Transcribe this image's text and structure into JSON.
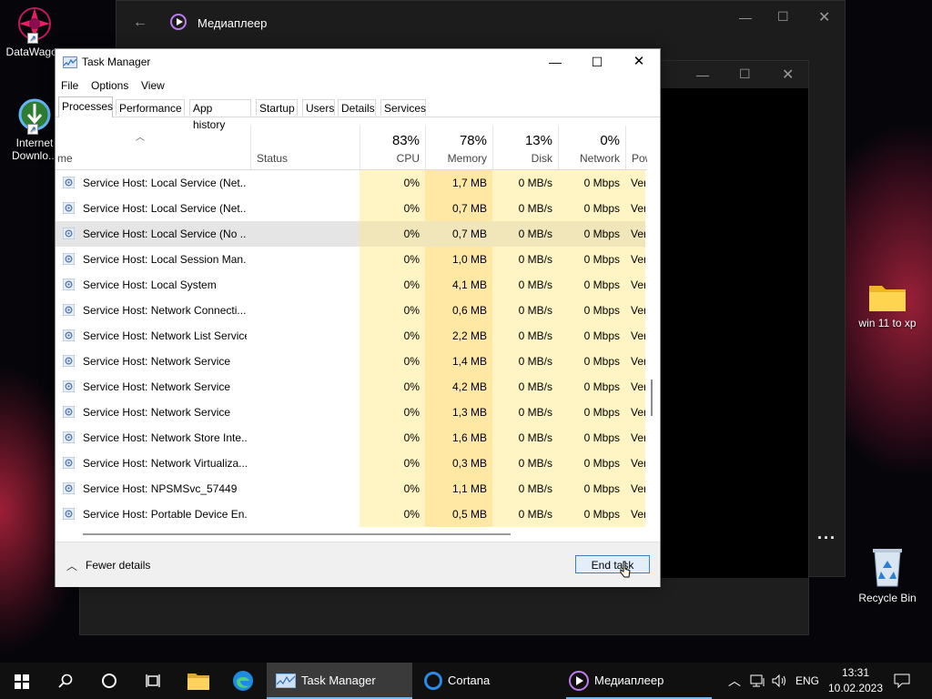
{
  "desktop": {
    "icons": [
      {
        "label": "DataWagon"
      },
      {
        "label": "Internet Downlo..."
      },
      {
        "label": "win 11 to xp"
      },
      {
        "label": "Recycle Bin"
      }
    ]
  },
  "media_window": {
    "title": "Медиаплеер"
  },
  "task_manager": {
    "title": "Task Manager",
    "menu": [
      "File",
      "Options",
      "View"
    ],
    "tabs": [
      "Processes",
      "Performance",
      "App history",
      "Startup",
      "Users",
      "Details",
      "Services"
    ],
    "active_tab": "Processes",
    "columns": {
      "name": "me",
      "status": "Status",
      "cpu": {
        "pct": "83%",
        "label": "CPU"
      },
      "memory": {
        "pct": "78%",
        "label": "Memory"
      },
      "disk": {
        "pct": "13%",
        "label": "Disk"
      },
      "network": {
        "pct": "0%",
        "label": "Network"
      },
      "power": {
        "label": "Powe"
      }
    },
    "rows": [
      {
        "name": "Service Host: Local Service (Net...",
        "cpu": "0%",
        "mem": "1,7 MB",
        "disk": "0 MB/s",
        "net": "0 Mbps",
        "pow": "Ver"
      },
      {
        "name": "Service Host: Local Service (Net...",
        "cpu": "0%",
        "mem": "0,7 MB",
        "disk": "0 MB/s",
        "net": "0 Mbps",
        "pow": "Ver"
      },
      {
        "name": "Service Host: Local Service (No ...",
        "cpu": "0%",
        "mem": "0,7 MB",
        "disk": "0 MB/s",
        "net": "0 Mbps",
        "pow": "Ver",
        "selected": true
      },
      {
        "name": "Service Host: Local Session Man...",
        "cpu": "0%",
        "mem": "1,0 MB",
        "disk": "0 MB/s",
        "net": "0 Mbps",
        "pow": "Ver"
      },
      {
        "name": "Service Host: Local System",
        "cpu": "0%",
        "mem": "4,1 MB",
        "disk": "0 MB/s",
        "net": "0 Mbps",
        "pow": "Ver"
      },
      {
        "name": "Service Host: Network Connecti...",
        "cpu": "0%",
        "mem": "0,6 MB",
        "disk": "0 MB/s",
        "net": "0 Mbps",
        "pow": "Ver"
      },
      {
        "name": "Service Host: Network List Service",
        "cpu": "0%",
        "mem": "2,2 MB",
        "disk": "0 MB/s",
        "net": "0 Mbps",
        "pow": "Ver"
      },
      {
        "name": "Service Host: Network Service",
        "cpu": "0%",
        "mem": "1,4 MB",
        "disk": "0 MB/s",
        "net": "0 Mbps",
        "pow": "Ver"
      },
      {
        "name": "Service Host: Network Service",
        "cpu": "0%",
        "mem": "4,2 MB",
        "disk": "0 MB/s",
        "net": "0 Mbps",
        "pow": "Ver"
      },
      {
        "name": "Service Host: Network Service",
        "cpu": "0%",
        "mem": "1,3 MB",
        "disk": "0 MB/s",
        "net": "0 Mbps",
        "pow": "Ver"
      },
      {
        "name": "Service Host: Network Store Inte...",
        "cpu": "0%",
        "mem": "1,6 MB",
        "disk": "0 MB/s",
        "net": "0 Mbps",
        "pow": "Ver"
      },
      {
        "name": "Service Host: Network Virtualiza...",
        "cpu": "0%",
        "mem": "0,3 MB",
        "disk": "0 MB/s",
        "net": "0 Mbps",
        "pow": "Ver"
      },
      {
        "name": "Service Host: NPSMSvc_57449",
        "cpu": "0%",
        "mem": "1,1 MB",
        "disk": "0 MB/s",
        "net": "0 Mbps",
        "pow": "Ver"
      },
      {
        "name": "Service Host: Portable Device En...",
        "cpu": "0%",
        "mem": "0,5 MB",
        "disk": "0 MB/s",
        "net": "0 Mbps",
        "pow": "Ver"
      }
    ],
    "fewer_details": "Fewer details",
    "end_task": "End task"
  },
  "taskbar": {
    "apps": [
      {
        "label": "Task Manager",
        "active": true
      },
      {
        "label": "Cortana"
      },
      {
        "label": "Медиаплеер"
      }
    ],
    "lang": "ENG",
    "time": "13:31",
    "date": "10.02.2023"
  },
  "colors": {
    "accent": "#76b9ed",
    "cpu_heat": "#fff4c4",
    "mem_heat": "#ffe8a3"
  }
}
